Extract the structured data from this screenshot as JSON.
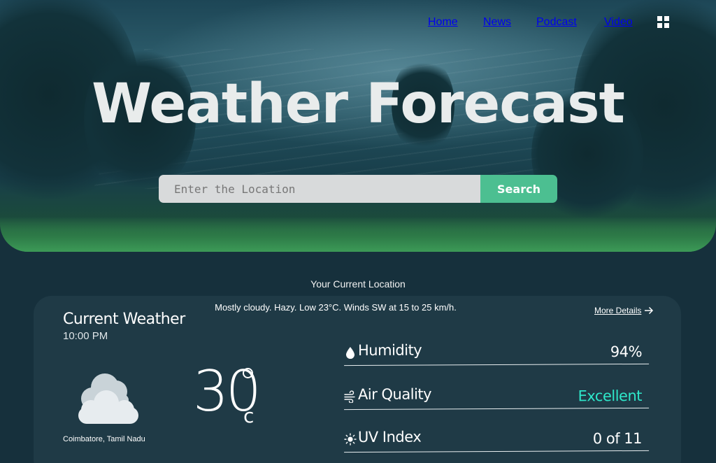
{
  "nav": {
    "items": [
      {
        "label": "Home"
      },
      {
        "label": "News"
      },
      {
        "label": "Podcast"
      },
      {
        "label": "Video"
      }
    ],
    "menu_icon": "grid-menu-icon"
  },
  "hero": {
    "title": "Weather Forecast",
    "search": {
      "placeholder": "Enter the Location",
      "value": "",
      "button_label": "Search"
    }
  },
  "location_label": "Your Current Location",
  "current": {
    "summary": "Mostly cloudy. Hazy. Low 23°C. Winds SW at 15 to 25 km/h.",
    "more_details_label": "More Details",
    "title": "Current Weather",
    "time": "10:00 PM",
    "condition_icon": "cloudy-icon",
    "city": "Coimbatore, Tamil Nadu",
    "temperature": "30",
    "unit": "c"
  },
  "metrics": [
    {
      "name": "Humidity",
      "value": "94%",
      "icon": "droplet-icon"
    },
    {
      "name": "Air Quality",
      "value": "Excellent",
      "icon": "wind-icon"
    },
    {
      "name": "UV Index",
      "value": "0 of 11",
      "icon": "sun-icon"
    }
  ],
  "colors": {
    "background": "#16303c",
    "card": "#1f3a46",
    "accent_button": "#4cbf91",
    "accent_text": "#2ee6c9"
  }
}
